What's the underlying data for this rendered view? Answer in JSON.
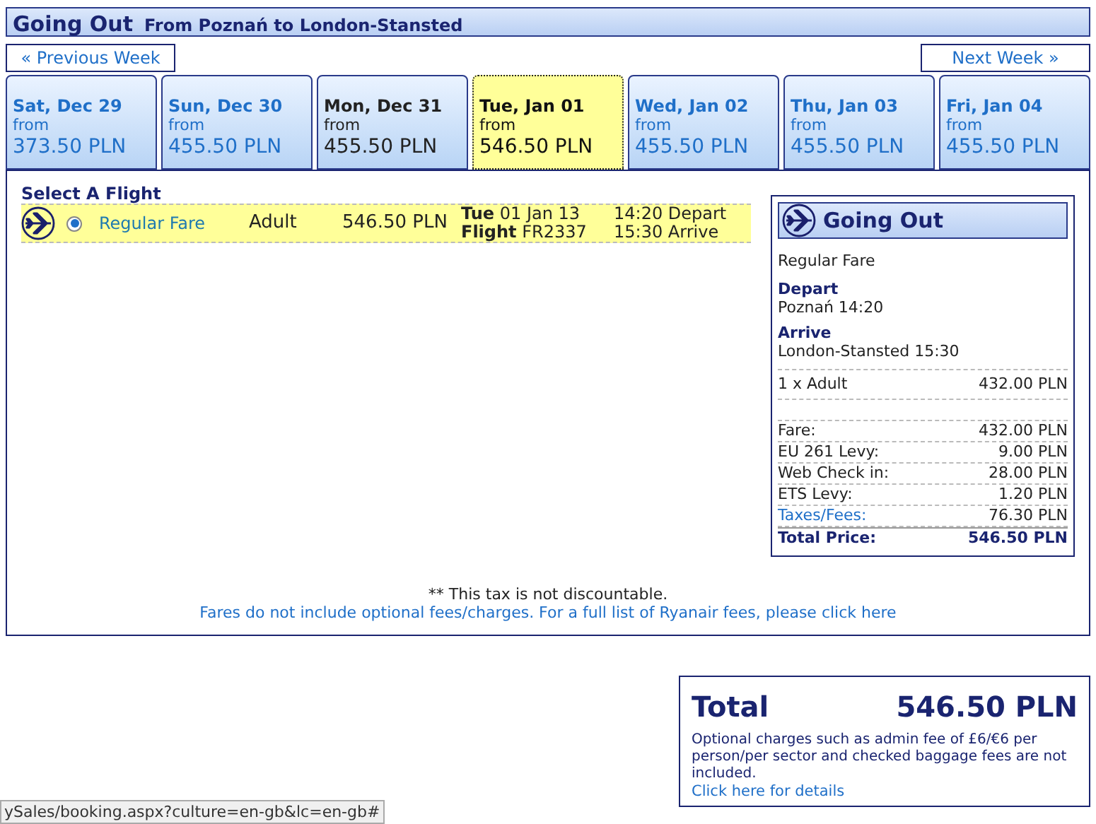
{
  "header": {
    "title": "Going Out",
    "route": "From Poznań to London-Stansted"
  },
  "nav": {
    "previous": "« Previous Week",
    "next": "Next Week »"
  },
  "days": [
    {
      "date": "Sat, Dec 29",
      "from": "from",
      "price": "373.50 PLN",
      "selected": false,
      "hovered": false
    },
    {
      "date": "Sun, Dec 30",
      "from": "from",
      "price": "455.50 PLN",
      "selected": false,
      "hovered": false
    },
    {
      "date": "Mon, Dec 31",
      "from": "from",
      "price": "455.50 PLN",
      "selected": false,
      "hovered": true
    },
    {
      "date": "Tue, Jan 01",
      "from": "from",
      "price": "546.50 PLN",
      "selected": true,
      "hovered": false
    },
    {
      "date": "Wed, Jan 02",
      "from": "from",
      "price": "455.50 PLN",
      "selected": false,
      "hovered": false
    },
    {
      "date": "Thu, Jan 03",
      "from": "from",
      "price": "455.50 PLN",
      "selected": false,
      "hovered": false
    },
    {
      "date": "Fri, Jan 04",
      "from": "from",
      "price": "455.50 PLN",
      "selected": false,
      "hovered": false
    }
  ],
  "select_heading": "Select A Flight",
  "flights": [
    {
      "selected": true,
      "fare": "Regular Fare",
      "passenger": "Adult",
      "price": "546.50 PLN",
      "day": "Tue",
      "date": "01 Jan 13",
      "flight_label": "Flight",
      "flight_no": "FR2337",
      "depart": "14:20 Depart",
      "arrive": "15:30 Arrive"
    }
  ],
  "summary": {
    "title": "Going Out",
    "fare": "Regular Fare",
    "depart_label": "Depart",
    "depart_value": "Poznań 14:20",
    "arrive_label": "Arrive",
    "arrive_value": "London-Stansted 15:30",
    "passenger_line": {
      "label": "1 x Adult",
      "value": "432.00 PLN"
    },
    "fees": [
      {
        "kind": "plain",
        "label": "Fare:",
        "value": "432.00 PLN"
      },
      {
        "kind": "plain",
        "label": "EU 261 Levy:",
        "value": "9.00 PLN"
      },
      {
        "kind": "plain",
        "label": "Web Check in:",
        "value": "28.00 PLN"
      },
      {
        "kind": "plain",
        "label": "ETS Levy:",
        "value": "1.20 PLN"
      },
      {
        "kind": "link",
        "label": "Taxes/Fees:",
        "value": "76.30 PLN"
      },
      {
        "kind": "total",
        "label": "Total Price:",
        "value": "546.50 PLN"
      }
    ]
  },
  "notes": {
    "tax": "** This tax is not discountable.",
    "fees_link": "Fares do not include optional fees/charges. For a full list of Ryanair fees, please click here"
  },
  "total": {
    "label": "Total",
    "value": "546.50 PLN",
    "note": "Optional charges such as admin fee of £6/€6 per person/per sector and checked baggage fees are not included.",
    "link": "Click here for details"
  },
  "status_bar": "ySales/booking.aspx?culture=en-gb&lc=en-gb#"
}
